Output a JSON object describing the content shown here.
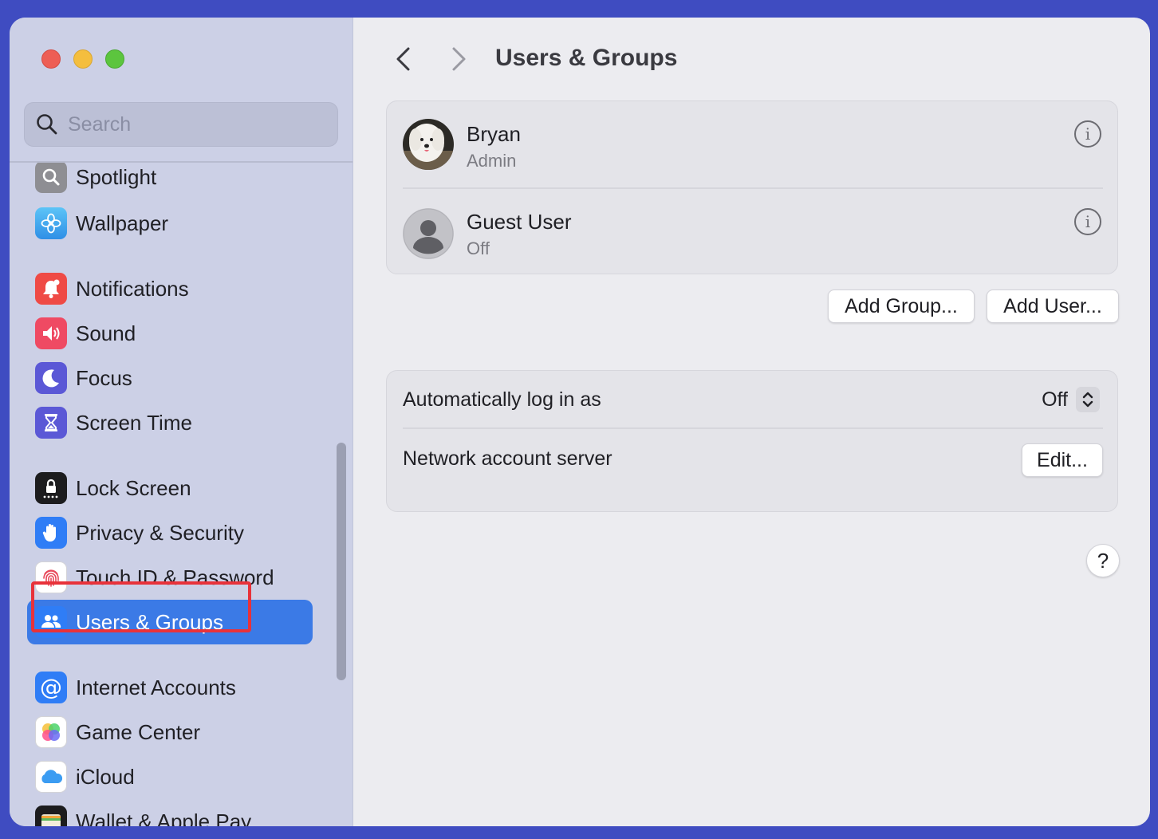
{
  "window": {
    "title": "Users & Groups"
  },
  "search": {
    "placeholder": "Search"
  },
  "sidebar": {
    "items": [
      {
        "label": "Spotlight",
        "icon": "spotlight-icon",
        "color": "#8e8e93"
      },
      {
        "label": "Wallpaper",
        "icon": "wallpaper-icon",
        "color": "#3aa9f0"
      },
      {
        "label": "Notifications",
        "icon": "bell-icon",
        "color": "#ef4a45"
      },
      {
        "label": "Sound",
        "icon": "speaker-icon",
        "color": "#ef4a63"
      },
      {
        "label": "Focus",
        "icon": "moon-icon",
        "color": "#5b58d6"
      },
      {
        "label": "Screen Time",
        "icon": "hourglass-icon",
        "color": "#5b58d6"
      },
      {
        "label": "Lock Screen",
        "icon": "lock-icon",
        "color": "#1c1c1e"
      },
      {
        "label": "Privacy & Security",
        "icon": "hand-icon",
        "color": "#2f7df6"
      },
      {
        "label": "Touch ID & Password",
        "icon": "fingerprint-icon",
        "color": "#ffffff"
      },
      {
        "label": "Users & Groups",
        "icon": "users-icon",
        "color": "#2f7df6"
      },
      {
        "label": "Internet Accounts",
        "icon": "at-icon",
        "color": "#2f7df6"
      },
      {
        "label": "Game Center",
        "icon": "game-center-icon",
        "color": "#ffffff"
      },
      {
        "label": "iCloud",
        "icon": "cloud-icon",
        "color": "#ffffff"
      },
      {
        "label": "Wallet & Apple Pay",
        "icon": "wallet-icon",
        "color": "#1c1c1e"
      }
    ]
  },
  "main": {
    "title": "Users & Groups",
    "users": [
      {
        "name": "Bryan",
        "role": "Admin",
        "avatar": "dog-photo-avatar"
      },
      {
        "name": "Guest User",
        "role": "Off",
        "avatar": "generic-person-avatar"
      }
    ],
    "add_group_label": "Add Group...",
    "add_user_label": "Add User...",
    "auto_login": {
      "label": "Automatically log in as",
      "value": "Off"
    },
    "network_server": {
      "label": "Network account server",
      "button": "Edit..."
    },
    "help_label": "?"
  }
}
